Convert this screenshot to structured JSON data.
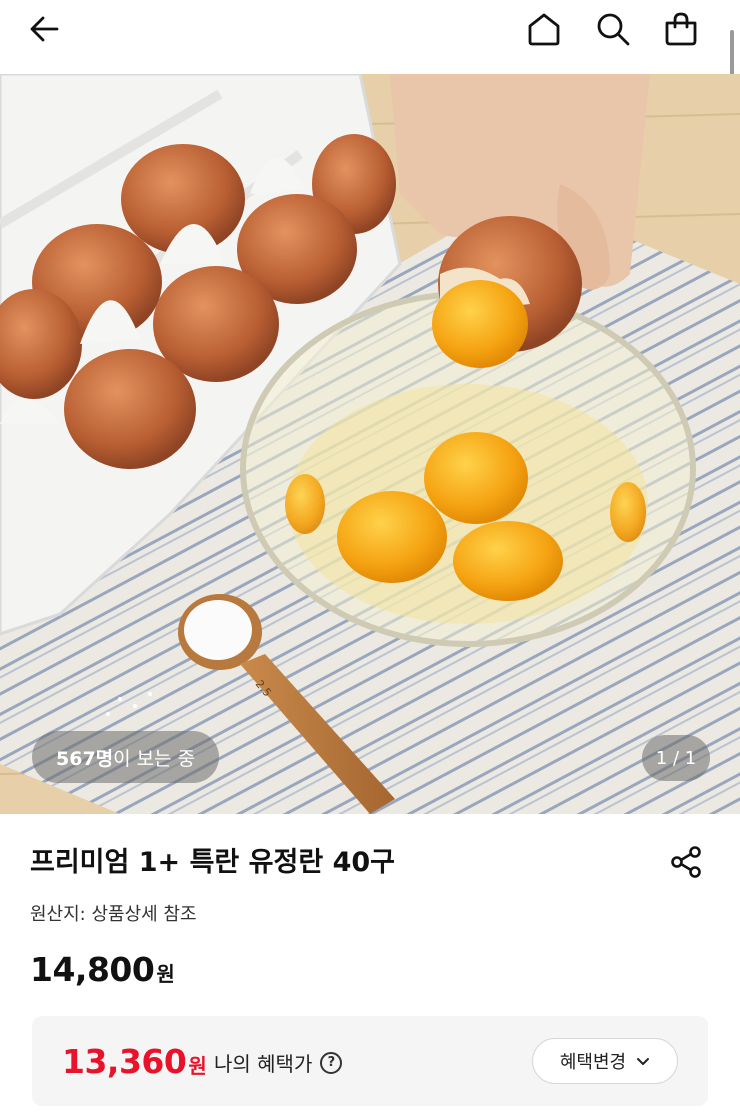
{
  "header": {
    "icons": {
      "back": "back-arrow-icon",
      "home": "home-icon",
      "search": "search-icon",
      "cart": "shopping-bag-icon"
    }
  },
  "gallery": {
    "viewer_count": "567명",
    "viewer_suffix": "이 보는 중",
    "page_counter": "1 / 1",
    "spoon_marking": "2.5"
  },
  "product": {
    "title": "프리미엄 1+ 특란 유정란 40구",
    "origin": "원산지: 상품상세 참조",
    "price": "14,800",
    "price_unit": "원",
    "share_icon": "share-icon"
  },
  "benefit": {
    "price": "13,360",
    "price_unit": "원",
    "label": "나의 혜택가",
    "help_icon": "?",
    "change_button": "혜택변경",
    "accent_color": "#e8132a"
  }
}
